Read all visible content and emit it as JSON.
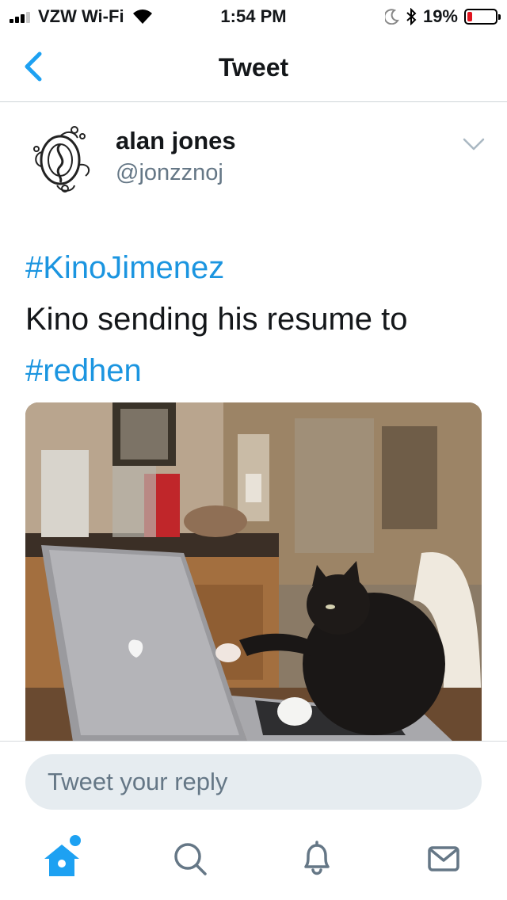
{
  "status_bar": {
    "carrier": "VZW Wi-Fi",
    "time": "1:54 PM",
    "battery": "19%",
    "battery_level": 0.19,
    "signal_bars": 3,
    "icons": [
      "wifi-icon",
      "moon-icon",
      "bluetooth-icon",
      "battery-icon"
    ]
  },
  "nav": {
    "title": "Tweet",
    "back_icon": "chevron-left-icon"
  },
  "tweet": {
    "author": {
      "name": "alan jones",
      "handle": "@jonzznoj"
    },
    "text": {
      "hashtag1": "#KinoJimenez",
      "body": "Kino sending his resume to",
      "hashtag2": "#redhen"
    },
    "media_icon": "cat-laptop-gif",
    "menu_icon": "chevron-down-icon"
  },
  "reply": {
    "placeholder": "Tweet your reply"
  },
  "tabs": [
    {
      "icon": "home-icon",
      "active": true
    },
    {
      "icon": "search-icon",
      "active": false
    },
    {
      "icon": "bell-icon",
      "active": false
    },
    {
      "icon": "mail-icon",
      "active": false
    }
  ],
  "colors": {
    "accent": "#1da1f2",
    "hashtag": "#1b95e0",
    "secondary_text": "#657786",
    "battery_low": "#e0141e"
  }
}
